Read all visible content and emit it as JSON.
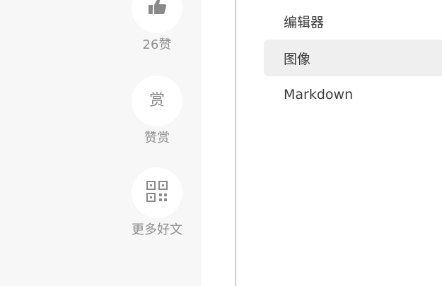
{
  "actions": {
    "like": {
      "icon": "thumbs-up-icon",
      "label": "26赞"
    },
    "reward": {
      "icon_text": "赏",
      "label": "赞赏"
    },
    "more": {
      "icon": "qr-code-icon",
      "label": "更多好文"
    }
  },
  "category_list": {
    "items": [
      {
        "label": "编辑器",
        "active": false
      },
      {
        "label": "图像",
        "active": true
      },
      {
        "label": "Markdown",
        "active": false
      }
    ]
  },
  "colors": {
    "panel_bg": "#f7f7f7",
    "icon_gray": "#8a8a8a",
    "active_bg": "#efefef",
    "text": "#3b3b3b"
  }
}
